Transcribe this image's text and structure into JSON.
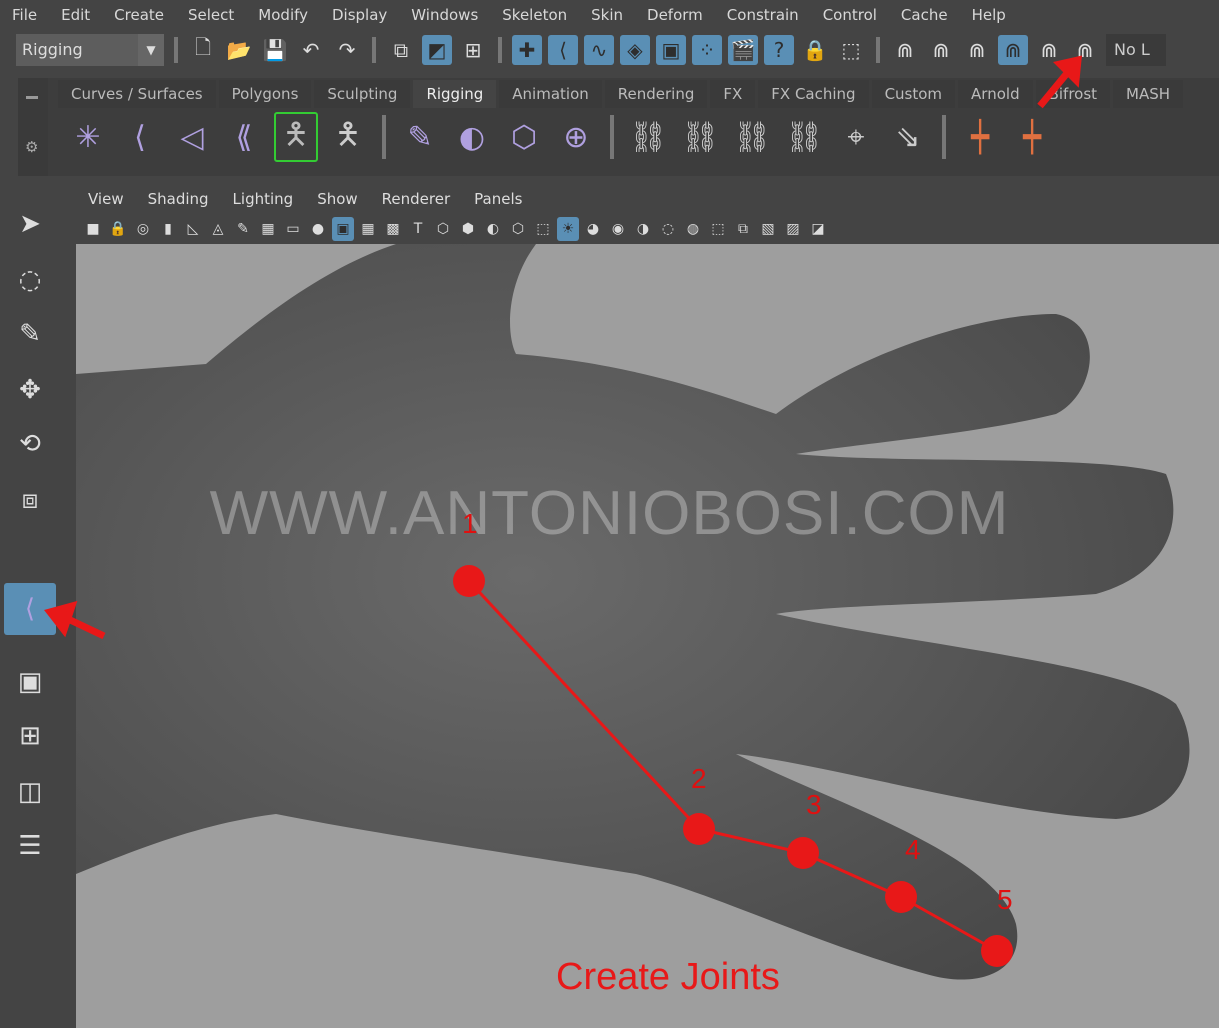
{
  "menu": [
    "File",
    "Edit",
    "Create",
    "Select",
    "Modify",
    "Display",
    "Windows",
    "Skeleton",
    "Skin",
    "Deform",
    "Constrain",
    "Control",
    "Cache",
    "Help"
  ],
  "status": {
    "menuset": "Rigging",
    "live_field": "No L"
  },
  "shelf": {
    "tabs": [
      "Curves / Surfaces",
      "Polygons",
      "Sculpting",
      "Rigging",
      "Animation",
      "Rendering",
      "FX",
      "FX Caching",
      "Custom",
      "Arnold",
      "Bifrost",
      "MASH"
    ],
    "active_tab": "Rigging"
  },
  "panel": {
    "menu": [
      "View",
      "Shading",
      "Lighting",
      "Show",
      "Renderer",
      "Panels"
    ]
  },
  "viewport": {
    "watermark": "WWW.ANTONIOBOSI.COM",
    "caption": "Create Joints",
    "joint_labels": [
      "1",
      "2",
      "3",
      "4",
      "5"
    ],
    "annotation_color": "#e81818",
    "active_tool": "create-joints"
  },
  "colors": {
    "active_button": "#5a8fb5",
    "ui_bg": "#444444",
    "viewport_bg": "#9e9e9e"
  }
}
